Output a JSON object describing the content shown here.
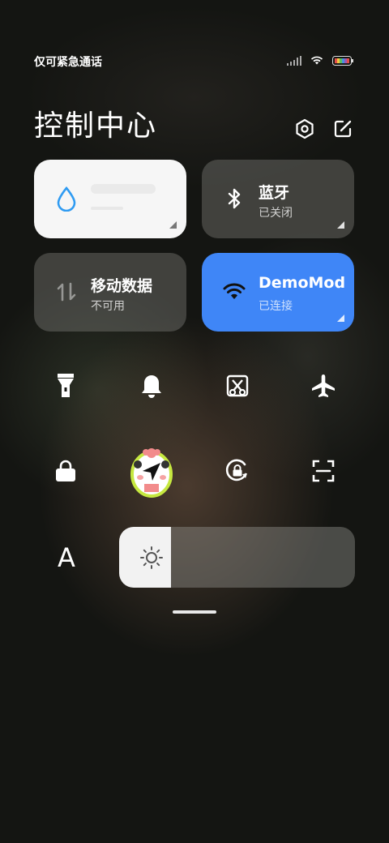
{
  "status_bar": {
    "carrier_text": "仅可紧急通话"
  },
  "header": {
    "title": "控制中心"
  },
  "tiles": [
    {
      "id": "data-usage",
      "label": "",
      "sub": "",
      "state": "on"
    },
    {
      "id": "bluetooth",
      "label": "蓝牙",
      "sub": "已关闭",
      "state": "off"
    },
    {
      "id": "mobile-data",
      "label": "移动数据",
      "sub": "不可用",
      "state": "disabled"
    },
    {
      "id": "wifi",
      "label": "DemoMod",
      "sub": "已连接",
      "state": "on"
    }
  ],
  "quick_buttons": [
    "flashlight-icon",
    "bell-icon",
    "screenshot-icon",
    "airplane-icon",
    "lock-icon",
    "location-icon",
    "rotation-lock-icon",
    "scan-icon"
  ],
  "font_button": {
    "label": "A"
  },
  "brightness": {
    "level": 0.22
  },
  "colors": {
    "accent_blue": "#3f86f7",
    "drop_blue": "#2f9bf2"
  }
}
